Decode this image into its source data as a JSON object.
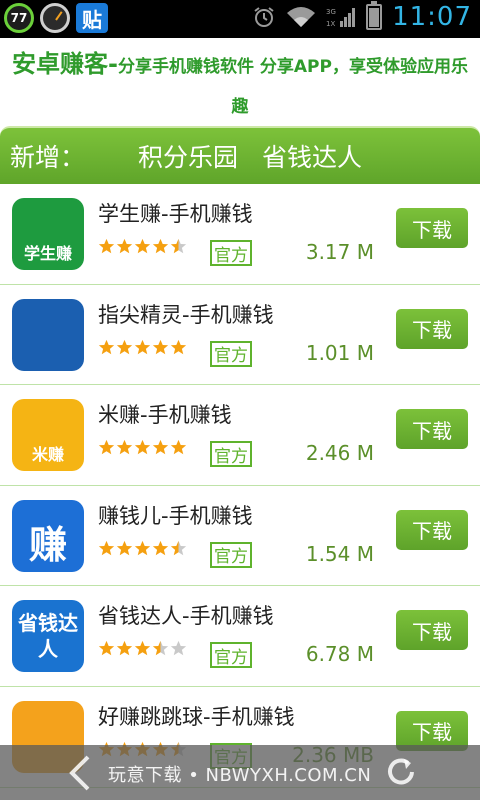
{
  "status_bar": {
    "notif_count": "77",
    "tie_label": "贴",
    "signal_labels": [
      "3G",
      "1X"
    ],
    "clock": "11:07",
    "battery_level": 0.85,
    "icons": [
      "alarm-icon",
      "wifi-icon",
      "signal-icon",
      "battery-icon"
    ]
  },
  "banner": {
    "title": "安卓赚客-",
    "text_1": "分享手机赚钱软件 分享APP，享受体验应用乐",
    "text_2": "趣"
  },
  "categories": {
    "label": "新增：",
    "tab_1": "积分乐园",
    "tab_2": "省钱达人"
  },
  "apps": [
    {
      "name": "学生赚-手机赚钱",
      "rating": 4.5,
      "official": "官方",
      "size": "3.17 M",
      "download": "下载",
      "icon_label": "学生赚",
      "icon_color": "#1e9b3f"
    },
    {
      "name": "指尖精灵-手机赚钱",
      "rating": 5,
      "official": "官方",
      "size": "1.01 M",
      "download": "下载",
      "icon_label": "",
      "icon_color": "#1b5fb0"
    },
    {
      "name": "米赚-手机赚钱",
      "rating": 5,
      "official": "官方",
      "size": "2.46 M",
      "download": "下载",
      "icon_label": "米赚",
      "icon_color": "#f5b414"
    },
    {
      "name": "赚钱儿-手机赚钱",
      "rating": 4.5,
      "official": "官方",
      "size": "1.54 M",
      "download": "下载",
      "icon_label": "赚",
      "icon_color": "#1d6fd6"
    },
    {
      "name": "省钱达人-手机赚钱",
      "rating": 3.5,
      "official": "官方",
      "size": "6.78 M",
      "download": "下载",
      "icon_label": "省钱达人",
      "icon_color": "#1a73d0"
    },
    {
      "name": "好赚跳跳球-手机赚钱",
      "rating": 4.5,
      "official": "官方",
      "size": "2.36 MB",
      "download": "下载",
      "icon_label": "",
      "icon_color": "#f4a21c"
    }
  ],
  "footer": {
    "text": "玩意下载 • NBWYXH.COM.CN",
    "icons": [
      "back-icon",
      "refresh-icon"
    ]
  },
  "colors": {
    "accent_green": "#5fa52a",
    "star_orange": "#f5a010",
    "status_blue": "#33b5e5"
  }
}
